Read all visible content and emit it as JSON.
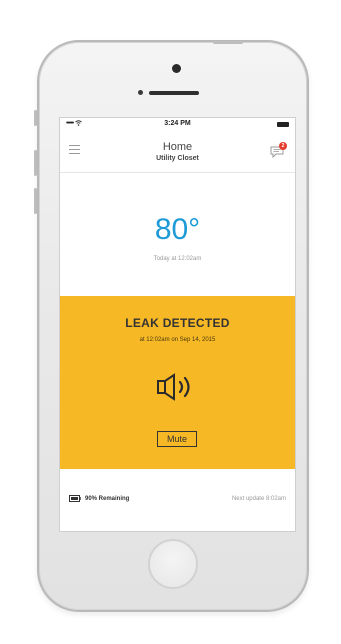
{
  "status_bar": {
    "carrier": "•••••",
    "time": "3:24 PM"
  },
  "header": {
    "title": "Home",
    "subtitle": "Utility Closet",
    "notification_count": "2"
  },
  "reading": {
    "temperature": "80°",
    "timestamp": "Today at 12:02am"
  },
  "alert": {
    "title": "LEAK DETECTED",
    "detail": "at 12:02am on Sep 14, 2015",
    "mute_label": "Mute"
  },
  "footer": {
    "battery": "90% Remaining",
    "next_update": "Next update 8:02am"
  },
  "icons": {
    "menu": "menu-icon",
    "chat": "chat-icon",
    "speaker": "speaker-icon",
    "battery": "battery-icon"
  },
  "colors": {
    "accent_blue": "#1e9ad6",
    "alert_yellow": "#f7b825",
    "badge_red": "#e53b2c"
  }
}
